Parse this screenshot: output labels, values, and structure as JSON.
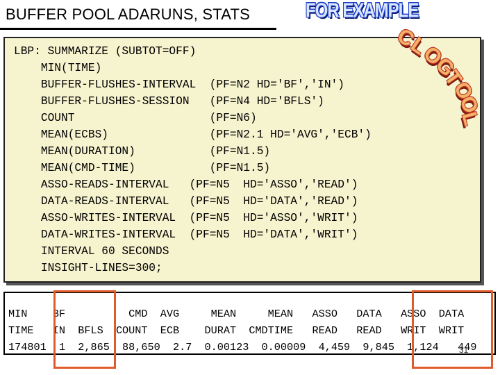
{
  "slide": {
    "title": "BUFFER POOL ADARUNS, STATS",
    "for_example": "FOR EXAMPLE",
    "clog_tool": [
      "C",
      "L",
      "O",
      "G",
      " ",
      "T",
      "O",
      "O",
      "L"
    ],
    "page_number": "31"
  },
  "code_lines": [
    "LBP: SUMMARIZE (SUBTOT=OFF)",
    "    MIN(TIME)",
    "    BUFFER-FLUSHES-INTERVAL  (PF=N2 HD='BF','IN')",
    "    BUFFER-FLUSHES-SESSION   (PF=N4 HD='BFLS')",
    "    COUNT                    (PF=N6)",
    "    MEAN(ECBS)               (PF=N2.1 HD='AVG','ECB')",
    "    MEAN(DURATION)           (PF=N1.5)",
    "    MEAN(CMD-TIME)           (PF=N1.5)",
    "    ASSO-READS-INTERVAL   (PF=N5  HD='ASSO','READ')",
    "    DATA-READS-INTERVAL   (PF=N5  HD='DATA','READ')",
    "    ASSO-WRITES-INTERVAL  (PF=N5  HD='ASSO','WRIT')",
    "    DATA-WRITES-INTERVAL  (PF=N5  HD='DATA','WRIT')",
    "    INTERVAL 60 SECONDS",
    "    INSIGHT-LINES=300;"
  ],
  "table_lines": [
    "MIN    BF          CMD  AVG     MEAN     MEAN   ASSO   DATA   ASSO  DATA",
    "TIME   IN  BFLS  COUNT  ECB    DURAT  CMDTIME   READ   READ   WRIT  WRIT",
    "174801  1  2,865  88,650  2.7  0.00123  0.00009  4,459  9,845  1,124   449"
  ],
  "colors": {
    "code_background": "#f6f3cf",
    "highlight": "#e05a2b",
    "for_example_fill": "#d9e6ff",
    "clog_fill": "#f4b266"
  }
}
